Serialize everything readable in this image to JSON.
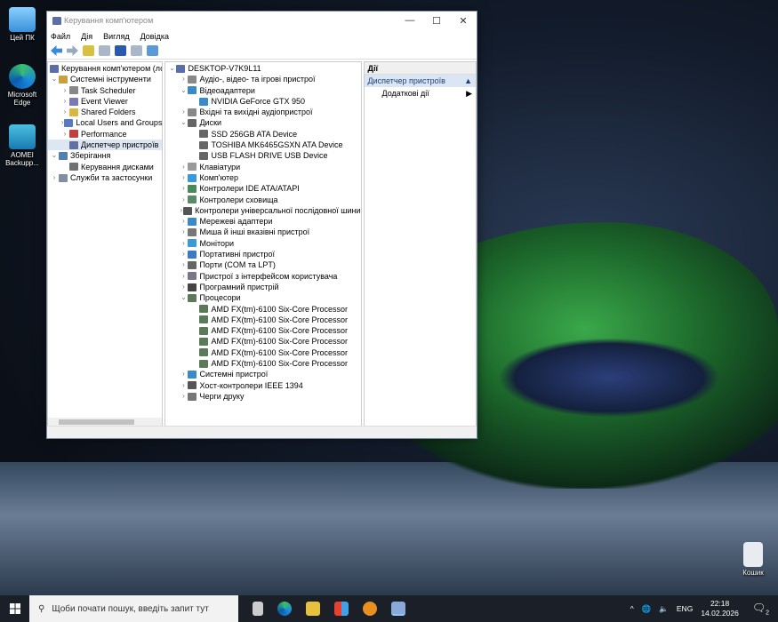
{
  "desktop": {
    "icons": [
      {
        "label": "Цей ПК"
      },
      {
        "label": "Microsoft Edge"
      },
      {
        "label": "AOMEI Backupp..."
      }
    ],
    "recycle_bin": "Кошик"
  },
  "window": {
    "title": "Керування комп'ютером",
    "menu": [
      "Файл",
      "Дія",
      "Вигляд",
      "Довідка"
    ],
    "left_tree": [
      {
        "label": "Керування комп'ютером (лок",
        "level": 0,
        "arrow": "",
        "color": "#5a6fa8"
      },
      {
        "label": "Системні інструменти",
        "level": 0,
        "arrow": "v",
        "color": "#c9a040"
      },
      {
        "label": "Task Scheduler",
        "level": 1,
        "arrow": ">",
        "color": "#888"
      },
      {
        "label": "Event Viewer",
        "level": 1,
        "arrow": ">",
        "color": "#7a7ab0"
      },
      {
        "label": "Shared Folders",
        "level": 1,
        "arrow": ">",
        "color": "#d8b840"
      },
      {
        "label": "Local Users and Groups",
        "level": 1,
        "arrow": ">",
        "color": "#5a7ac0"
      },
      {
        "label": "Performance",
        "level": 1,
        "arrow": ">",
        "color": "#c04040"
      },
      {
        "label": "Диспетчер пристроїв",
        "level": 1,
        "arrow": "",
        "color": "#6070a0",
        "selected": true
      },
      {
        "label": "Зберігання",
        "level": 0,
        "arrow": "v",
        "color": "#5080b0"
      },
      {
        "label": "Керування дисками",
        "level": 1,
        "arrow": "",
        "color": "#707070"
      },
      {
        "label": "Служби та застосунки",
        "level": 0,
        "arrow": ">",
        "color": "#8090a0"
      }
    ],
    "device_tree": [
      {
        "label": "DESKTOP-V7K9L11",
        "level": 0,
        "arrow": "v",
        "color": "#5a6fa8"
      },
      {
        "label": "Аудіо-, відео- та ігрові пристрої",
        "level": 1,
        "arrow": ">",
        "color": "#888"
      },
      {
        "label": "Відеоадаптери",
        "level": 1,
        "arrow": "v",
        "color": "#3a8ac8"
      },
      {
        "label": "NVIDIA GeForce GTX 950",
        "level": 2,
        "arrow": "",
        "color": "#3a8ac8"
      },
      {
        "label": "Вхідні та вихідні аудіопристрої",
        "level": 1,
        "arrow": ">",
        "color": "#888"
      },
      {
        "label": "Диски",
        "level": 1,
        "arrow": "v",
        "color": "#666"
      },
      {
        "label": "SSD 256GB ATA Device",
        "level": 2,
        "arrow": "",
        "color": "#666"
      },
      {
        "label": "TOSHIBA MK6465GSXN ATA Device",
        "level": 2,
        "arrow": "",
        "color": "#666"
      },
      {
        "label": "USB FLASH DRIVE USB Device",
        "level": 2,
        "arrow": "",
        "color": "#666"
      },
      {
        "label": "Клавіатури",
        "level": 1,
        "arrow": ">",
        "color": "#999"
      },
      {
        "label": "Комп'ютер",
        "level": 1,
        "arrow": ">",
        "color": "#3a9ad8"
      },
      {
        "label": "Контролери IDE ATA/ATAPI",
        "level": 1,
        "arrow": ">",
        "color": "#4a8a5a"
      },
      {
        "label": "Контролери сховища",
        "level": 1,
        "arrow": ">",
        "color": "#5a8a6a"
      },
      {
        "label": "Контролери універсальної послідовної шини",
        "level": 1,
        "arrow": ">",
        "color": "#555"
      },
      {
        "label": "Мережеві адаптери",
        "level": 1,
        "arrow": ">",
        "color": "#3a8ac8"
      },
      {
        "label": "Миша й інші вказівні пристрої",
        "level": 1,
        "arrow": ">",
        "color": "#777"
      },
      {
        "label": "Монітори",
        "level": 1,
        "arrow": ">",
        "color": "#3a9ad8"
      },
      {
        "label": "Портативні пристрої",
        "level": 1,
        "arrow": ">",
        "color": "#3a7ac8"
      },
      {
        "label": "Порти (COM та LPT)",
        "level": 1,
        "arrow": ">",
        "color": "#666"
      },
      {
        "label": "Пристрої з інтерфейсом користувача",
        "level": 1,
        "arrow": ">",
        "color": "#778"
      },
      {
        "label": "Програмний пристрій",
        "level": 1,
        "arrow": ">",
        "color": "#444"
      },
      {
        "label": "Процесори",
        "level": 1,
        "arrow": "v",
        "color": "#5a7a5a"
      },
      {
        "label": "AMD FX(tm)-6100 Six-Core Processor",
        "level": 2,
        "arrow": "",
        "color": "#5a7a5a"
      },
      {
        "label": "AMD FX(tm)-6100 Six-Core Processor",
        "level": 2,
        "arrow": "",
        "color": "#5a7a5a"
      },
      {
        "label": "AMD FX(tm)-6100 Six-Core Processor",
        "level": 2,
        "arrow": "",
        "color": "#5a7a5a"
      },
      {
        "label": "AMD FX(tm)-6100 Six-Core Processor",
        "level": 2,
        "arrow": "",
        "color": "#5a7a5a"
      },
      {
        "label": "AMD FX(tm)-6100 Six-Core Processor",
        "level": 2,
        "arrow": "",
        "color": "#5a7a5a"
      },
      {
        "label": "AMD FX(tm)-6100 Six-Core Processor",
        "level": 2,
        "arrow": "",
        "color": "#5a7a5a"
      },
      {
        "label": "Системні пристрої",
        "level": 1,
        "arrow": ">",
        "color": "#3a8ac8"
      },
      {
        "label": "Хост-контролери IEEE 1394",
        "level": 1,
        "arrow": ">",
        "color": "#555"
      },
      {
        "label": "Черги друку",
        "level": 1,
        "arrow": ">",
        "color": "#777"
      }
    ],
    "actions": {
      "header": "Дії",
      "section": "Диспетчер пристроїв",
      "more": "Додаткові дії"
    }
  },
  "taskbar": {
    "search_placeholder": "Щоби почати пошук, введіть запит тут",
    "lang": "ENG",
    "time": "22:18",
    "date": "14.02.2026",
    "notifications": "2"
  }
}
